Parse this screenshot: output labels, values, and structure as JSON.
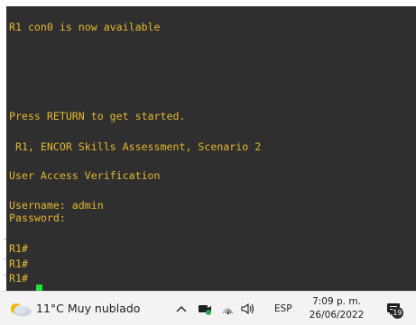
{
  "terminal": {
    "lines": [
      "R1 con0 is now available",
      "Press RETURN to get started.",
      " R1, ENCOR Skills Assessment, Scenario 2",
      "User Access Verification",
      "Username: admin",
      "Password:",
      "R1#",
      "R1#",
      "R1#"
    ],
    "text_color": "#e4b830",
    "background": "#2f2f2f",
    "cursor_color": "#22e03a"
  },
  "taskbar": {
    "weather": {
      "icon": "partly-cloudy-icon",
      "text": "11°C  Muy nublado"
    },
    "tray_chevron": "^",
    "language": "ESP",
    "time": "7:09 p. m.",
    "date": "26/06/2022",
    "notification_count": "19"
  }
}
